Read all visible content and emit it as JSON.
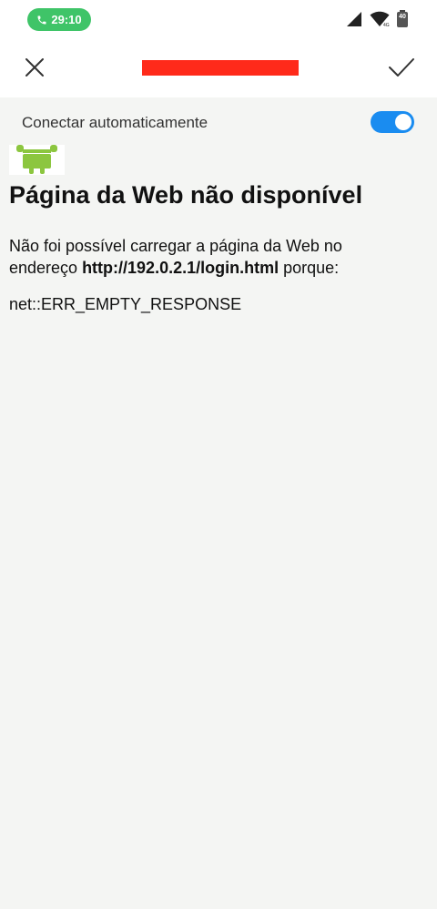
{
  "status_bar": {
    "call_time": "29:10",
    "call_icon": "phone-icon",
    "signal_icon": "cell-signal-icon",
    "wifi_icon": "wifi-icon",
    "battery_icon": "battery-icon",
    "battery_level": "40"
  },
  "header": {
    "close_icon": "close-icon",
    "title": "",
    "confirm_icon": "check-icon"
  },
  "auto_connect": {
    "label": "Conectar automaticamente",
    "enabled": true,
    "accent_color": "#1a8cf0"
  },
  "webpage": {
    "image_icon": "android-icon",
    "title": "Página da Web não disponível",
    "body_prefix": "Não foi possível carregar a página da Web no endereço ",
    "url": "http://192.0.2.1/login.html",
    "body_suffix": " porque:",
    "error_code": "net::ERR_EMPTY_RESPONSE"
  },
  "colors": {
    "call_pill": "#3fc468",
    "title_redaction": "#ff2a1a",
    "background": "#f4f5f3"
  }
}
